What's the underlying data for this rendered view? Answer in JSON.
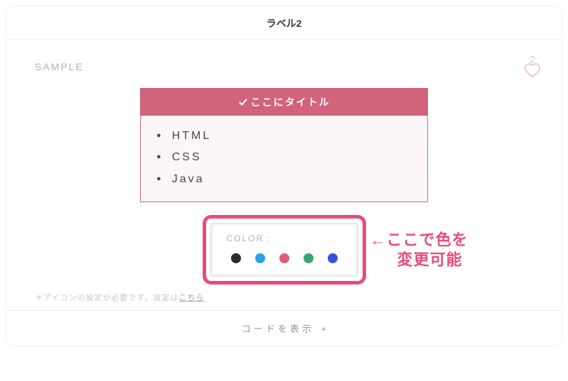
{
  "tab": {
    "label": "ラベル2"
  },
  "sample_label": "SAMPLE",
  "like": {
    "count": "2"
  },
  "box1": {
    "title": "ここにタイトル",
    "items": [
      "HTML",
      "CSS",
      "Java"
    ]
  },
  "picker": {
    "label": "COLOR :",
    "colors": [
      "#2b2b2b",
      "#2da0e0",
      "#e05c7a",
      "#3aa772",
      "#3553d6"
    ]
  },
  "annotation": {
    "line1": "←ここで色を",
    "line2": "変更可能"
  },
  "footnote": {
    "prefix": "＊アイコンの設定が必要です。設定は",
    "link": "こちら"
  },
  "footer": {
    "label": "コードを表示",
    "plus": "+"
  }
}
